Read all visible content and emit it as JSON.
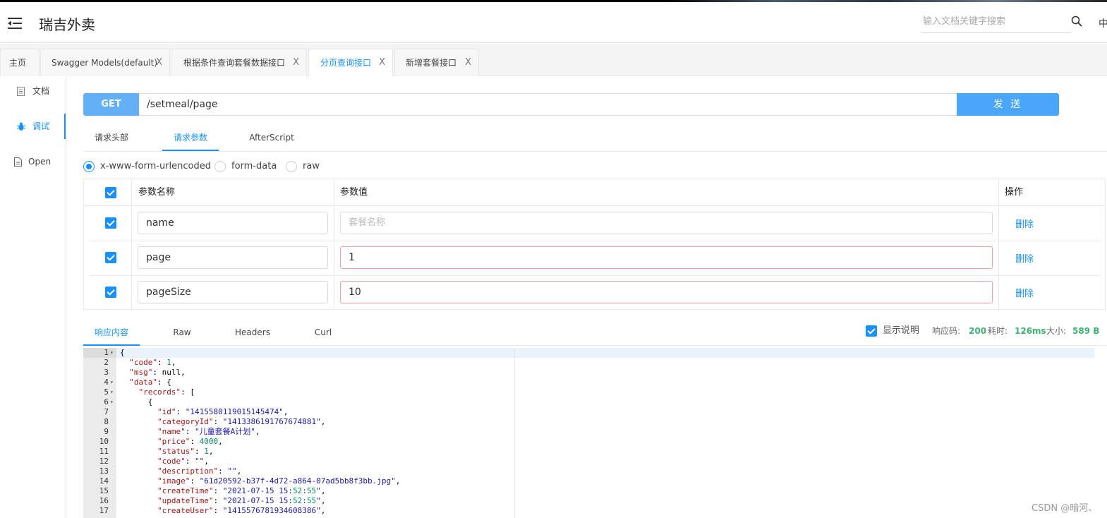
{
  "app": {
    "title": "瑞吉外卖",
    "lang_label": "中"
  },
  "search": {
    "placeholder": "输入文档关键字搜索"
  },
  "tabs": [
    {
      "label": "主页",
      "closable": false
    },
    {
      "label": "Swagger Models(default)",
      "closable": true
    },
    {
      "label": "根据条件查询套餐数据接口",
      "closable": true
    },
    {
      "label": "分页查询接口",
      "closable": true,
      "active": true
    },
    {
      "label": "新增套餐接口",
      "closable": true
    }
  ],
  "tab_close_glyph": "X",
  "sidebar": [
    {
      "label": "文档",
      "icon": "document-icon"
    },
    {
      "label": "调试",
      "icon": "bug-icon",
      "active": true
    },
    {
      "label": "Open",
      "icon": "file-icon"
    }
  ],
  "request": {
    "method": "GET",
    "url": "/setmeal/page",
    "send_label": "发 送"
  },
  "request_tabs": [
    "请求头部",
    "请求参数",
    "AfterScript"
  ],
  "body_types": [
    "x-www-form-urlencoded",
    "form-data",
    "raw"
  ],
  "param_table": {
    "headers": {
      "name": "参数名称",
      "value": "参数值",
      "action": "操作"
    },
    "rows": [
      {
        "name": "name",
        "value": "",
        "placeholder": "套餐名称",
        "checked": true,
        "action": "删除"
      },
      {
        "name": "page",
        "value": "1",
        "placeholder": "",
        "checked": true,
        "action": "删除"
      },
      {
        "name": "pageSize",
        "value": "10",
        "placeholder": "",
        "checked": true,
        "action": "删除"
      }
    ]
  },
  "response_tabs": [
    "响应内容",
    "Raw",
    "Headers",
    "Curl"
  ],
  "response_stats": {
    "show_desc_label": "显示说明",
    "code_label": "响应码:",
    "code": "200",
    "time_label": "耗时:",
    "time": "126ms",
    "size_label": "大小:",
    "size": "589 B"
  },
  "code_lines": [
    "{",
    "  \"code\": 1,",
    "  \"msg\": null,",
    "  \"data\": {",
    "    \"records\": [",
    "      {",
    "        \"id\": \"1415580119015145474\",",
    "        \"categoryId\": \"1413386191767674881\",",
    "        \"name\": \"儿童套餐A计划\",",
    "        \"price\": 4000,",
    "        \"status\": 1,",
    "        \"code\": \"\",",
    "        \"description\": \"\",",
    "        \"image\": \"61d20592-b37f-4d72-a864-07ad5bb8f3bb.jpg\",",
    "        \"createTime\": \"2021-07-15 15:52:55\",",
    "        \"updateTime\": \"2021-07-15 15:52:55\",",
    "        \"createUser\": \"1415576781934608386\","
  ],
  "fold_lines": [
    1,
    4,
    5,
    6
  ],
  "watermark": "CSDN @暗河、",
  "colors": {
    "accent": "#1890ff",
    "method_bg": "#64b0f6",
    "send_bg": "#4aa6f8",
    "success": "#3cb371"
  }
}
